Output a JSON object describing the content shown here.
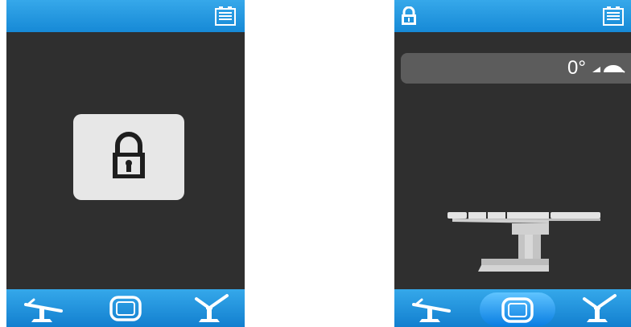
{
  "left_screen": {
    "top_bar": {
      "battery_icon": "battery-icon"
    },
    "lock_panel": {
      "icon": "padlock-icon"
    },
    "bottom_nav": [
      {
        "id": "tilt",
        "icon": "table-tilt-icon",
        "active": false
      },
      {
        "id": "screen",
        "icon": "display-icon",
        "active": false
      },
      {
        "id": "legs",
        "icon": "leg-section-icon",
        "active": false
      }
    ]
  },
  "right_screen": {
    "top_bar": {
      "lock_icon": "lock-icon",
      "battery_icon": "battery-icon"
    },
    "angle": {
      "value": "0°",
      "icon": "rotation-icon"
    },
    "table_illustration": "operating-table-icon",
    "bottom_nav": [
      {
        "id": "tilt",
        "icon": "table-tilt-icon",
        "active": false
      },
      {
        "id": "screen",
        "icon": "display-icon",
        "active": true
      },
      {
        "id": "legs",
        "icon": "leg-section-icon",
        "active": false
      }
    ]
  },
  "colors": {
    "bar_blue": "#1e92dc",
    "screen_bg": "#2f2f2f",
    "panel_bg": "#e7e7e7",
    "pill_bg": "#5c5c5c",
    "active_tab": "#2a9cf2"
  }
}
